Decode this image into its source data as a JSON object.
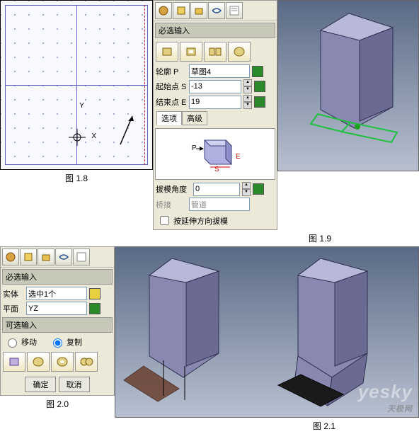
{
  "captions": {
    "c18": "图 1.8",
    "c19": "图 1.9",
    "c20": "图 2.0",
    "c21": "图 2.1"
  },
  "panel19": {
    "section1": "必选输入",
    "profile_lbl": "轮廓 P",
    "profile_val": "草图4",
    "start_lbl": "起始点 S",
    "start_val": "-13",
    "end_lbl": "结束点 E",
    "end_val": "19",
    "tab1": "选项",
    "tab2": "高级",
    "diag_p": "P",
    "diag_s": "S",
    "diag_e": "E",
    "draft_lbl": "拔模角度",
    "draft_val": "0",
    "bridge_lbl": "桥接",
    "bridge_val": "管道",
    "chk": "按延伸方向拔模"
  },
  "panel20": {
    "section1": "必选输入",
    "body_lbl": "实体",
    "body_val": "选中1个",
    "plane_lbl": "平面",
    "plane_val": "YZ",
    "section2": "可选输入",
    "radio_move": "移动",
    "radio_copy": "复制",
    "ok": "确定",
    "cancel": "取消"
  },
  "sketch": {
    "axis_y": "Y",
    "axis_x": "X"
  },
  "watermark": "yesky",
  "watermark_sub": "天极网"
}
